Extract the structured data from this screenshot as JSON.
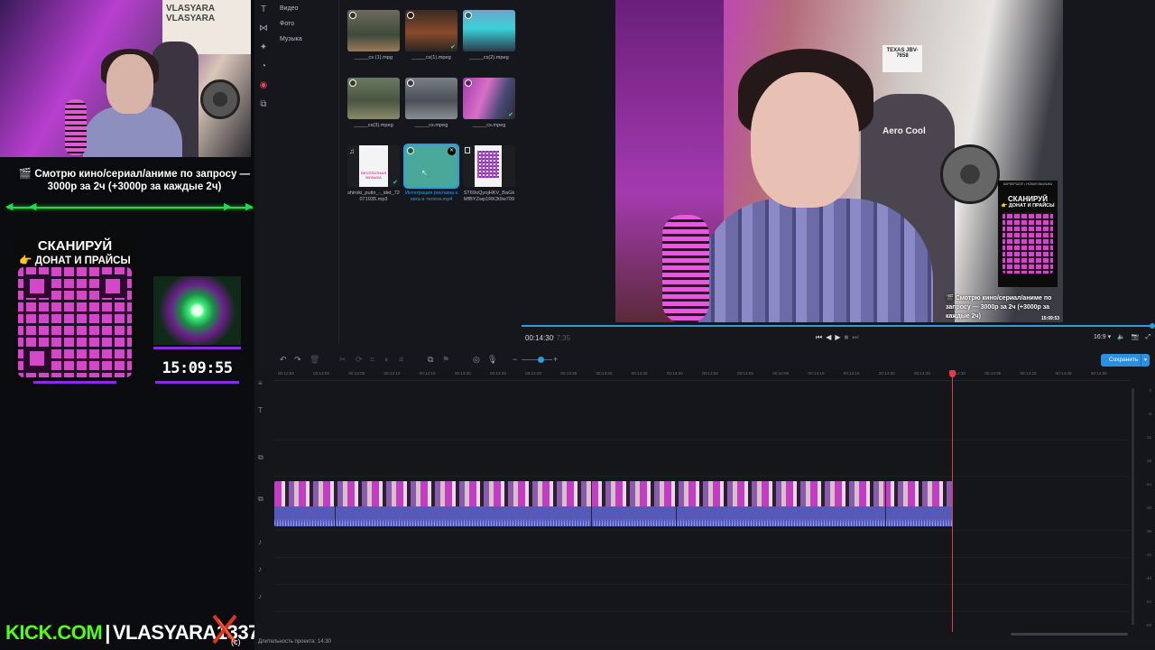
{
  "overlay": {
    "poster_text": "VLASYARA\nVLASYARA",
    "movie_request_text": "🎬 Смотрю кино/сериал/аниме по запросу — 3000р за 2ч (+3000р за каждые 2ч)",
    "donate_title": "СКАНИРУЙ",
    "donate_subtitle": "👉 ДОНАТ И ПРАЙСЫ",
    "clock_time": "15:09:55",
    "kick_site": "KICK.COM",
    "kick_separator": "|",
    "kick_channel": "VLASYARA1337",
    "copyright": "(c)",
    "colors": {
      "kick_green": "#53fc18",
      "qr_pink": "#d447c9",
      "accent_purple": "#8a2be2",
      "arrow_green": "#1fdc4a"
    }
  },
  "editor": {
    "toolbar_icons": [
      "text-icon",
      "transition-icon",
      "effects-icon",
      "sticker-icon",
      "record-icon",
      "split-icon"
    ],
    "media_nav": [
      "Видео",
      "Фото",
      "Музыка"
    ],
    "media_items": [
      {
        "label": "_____cs (1).mpg",
        "kind": "video"
      },
      {
        "label": "_____cs(1).mpeg",
        "kind": "video"
      },
      {
        "label": "_____cs(2).mpeg",
        "kind": "video"
      },
      {
        "label": "_____cs(3).mpeg",
        "kind": "video"
      },
      {
        "label": "_____cs.mpeg",
        "kind": "video"
      },
      {
        "label": "_____cs.mpeg",
        "kind": "video"
      },
      {
        "label": "shiroki_putin_-_idet_72071035.mp3",
        "kind": "audio",
        "thumb_text": "БЕСПЛАТНАЯ МУЗЫКА"
      },
      {
        "label": "Интеграция реклама книга и телеги.mp4",
        "kind": "video",
        "selected": true
      },
      {
        "label": "ST69oQyojHKV_BaGkMfBYZwp1RK3t9w709",
        "kind": "image"
      }
    ],
    "preview": {
      "plate_text": "TEXAS JBV-7658",
      "chair_brand": "Aero Cool",
      "mini_card_head": "БАРБЕРШОП • НОВАЯ МЫЗЫКА",
      "mini_card_title": "СКАНИРУЙ",
      "mini_card_subtitle": "👉 ДОНАТ И ПРАЙСЫ",
      "mini_text": "🎬 Смотрю кино/сериал/аниме по запросу — 3000р за 2ч (+3000р за каждые 2ч)",
      "mini_clock": "15:09:53"
    },
    "player": {
      "current_time": "00:14:30",
      "total_time": "/ 7:35",
      "aspect_ratio": "16:9 ▾",
      "progress": 1.0
    },
    "timeline_toolbar": {
      "undo": "↶",
      "redo": "↷",
      "delete": "🗑",
      "zoom_out": "−",
      "zoom_in": "+",
      "save_label": "Сохранить",
      "zoom_level": 0.55
    },
    "ruler_ticks": [
      "00:12:55",
      "00:13:00",
      "00:13:05",
      "00:13:10",
      "00:13:15",
      "00:13:20",
      "00:13:25",
      "00:13:30",
      "00:13:35",
      "00:13:40",
      "00:13:45",
      "00:13:50",
      "00:13:55",
      "00:14:00",
      "00:14:05",
      "00:14:10",
      "00:14:15",
      "00:14:20",
      "00:14:25",
      "00:14:30",
      "00:14:35",
      "00:14:40",
      "00:14:45",
      "00:14:50"
    ],
    "meter_ticks": [
      "0",
      "-6",
      "-12",
      "-18",
      "-24",
      "-30",
      "-36",
      "-42",
      "-48",
      "-54",
      "-60"
    ],
    "status_text": "Длительность проекта: 14:30",
    "colors": {
      "accent_blue": "#2d9de0",
      "playhead_red": "#e23b4a",
      "clip_purple": "#5a58b8"
    }
  }
}
